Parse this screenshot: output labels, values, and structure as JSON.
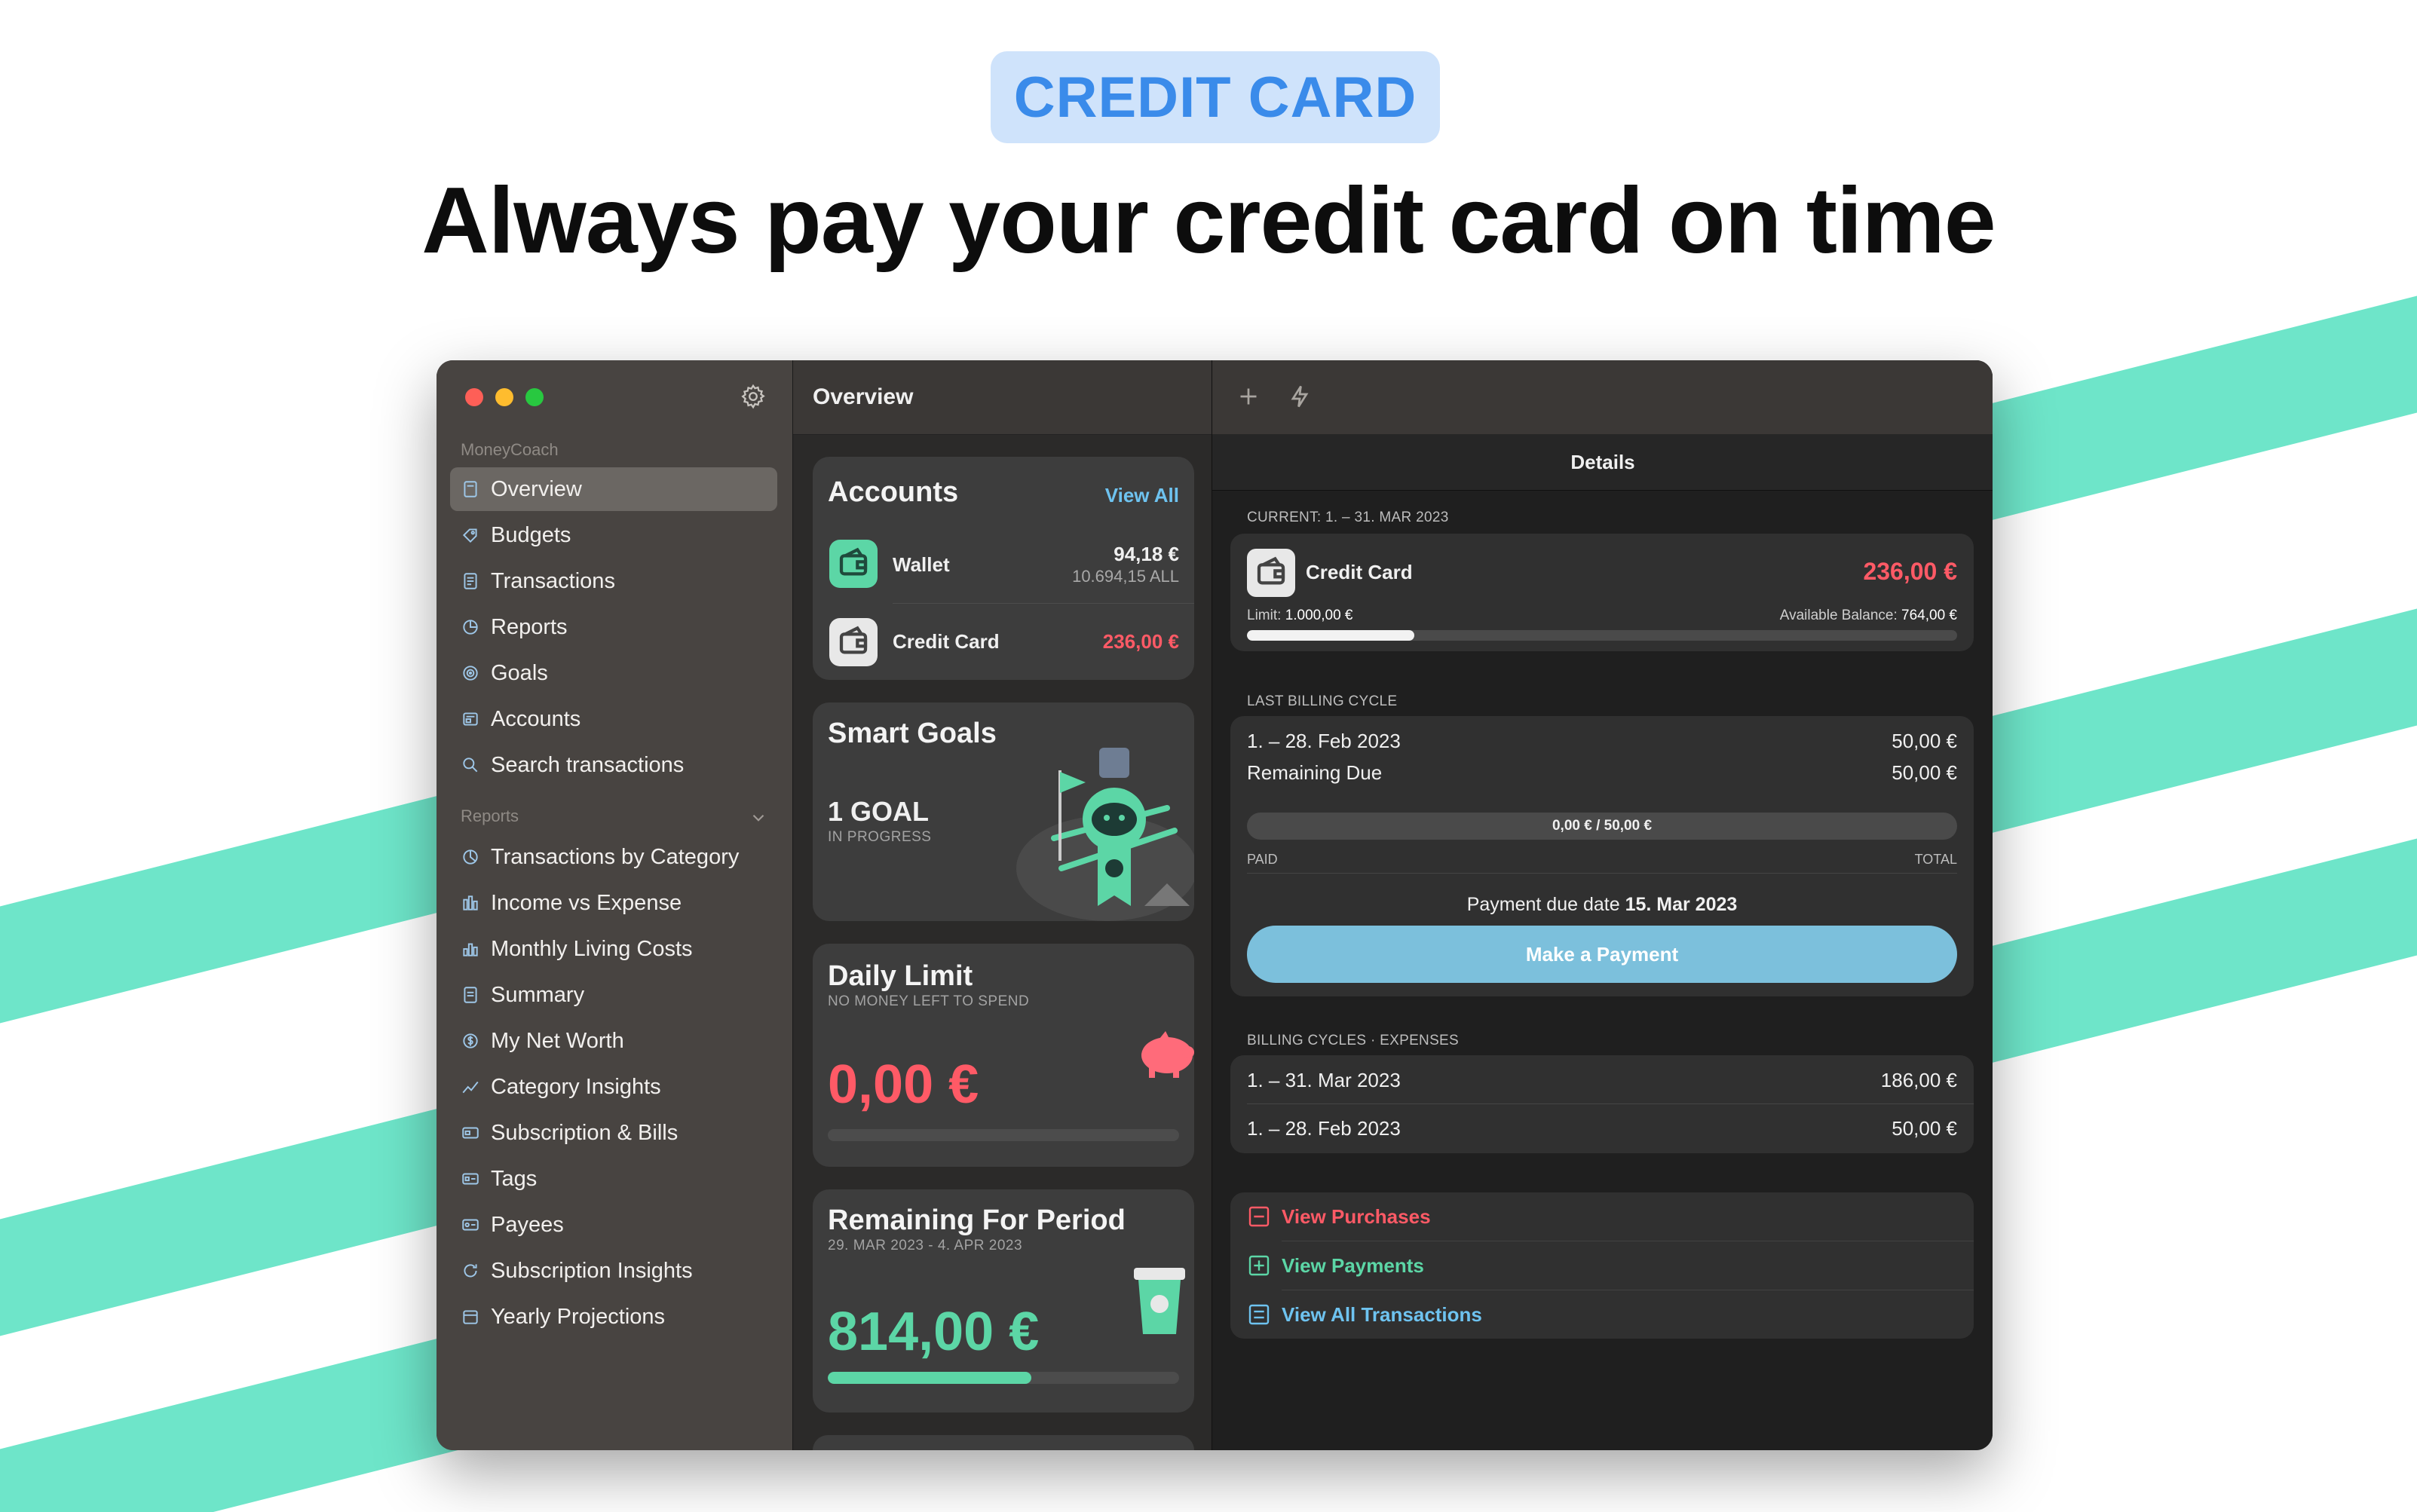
{
  "badge": "CREDIT CARD",
  "headline": "Always pay your credit card on time",
  "colors": {
    "stripe": "#6ee5c9",
    "badge_bg": "#cfe3fb",
    "badge_text": "#3a8bea",
    "negative": "#ff5a66",
    "positive": "#5cd6a6",
    "link_blue": "#6ec3f0",
    "button": "#7cc0dc"
  },
  "sidebar": {
    "app_section": "MoneyCoach",
    "items": [
      {
        "label": "Overview",
        "icon": "overview-icon"
      },
      {
        "label": "Budgets",
        "icon": "budgets-icon"
      },
      {
        "label": "Transactions",
        "icon": "transactions-icon"
      },
      {
        "label": "Reports",
        "icon": "reports-icon"
      },
      {
        "label": "Goals",
        "icon": "goals-icon"
      },
      {
        "label": "Accounts",
        "icon": "accounts-icon"
      },
      {
        "label": "Search transactions",
        "icon": "search-icon"
      }
    ],
    "reports_section": "Reports",
    "reports": [
      {
        "label": "Transactions by Category",
        "icon": "pie-chart-icon"
      },
      {
        "label": "Income vs Expense",
        "icon": "bar-chart-icon"
      },
      {
        "label": "Monthly Living Costs",
        "icon": "bar-chart-icon"
      },
      {
        "label": "Summary",
        "icon": "summary-icon"
      },
      {
        "label": "My Net Worth",
        "icon": "dollar-icon"
      },
      {
        "label": "Category Insights",
        "icon": "line-chart-icon"
      },
      {
        "label": "Subscription & Bills",
        "icon": "card-icon"
      },
      {
        "label": "Tags",
        "icon": "tag-icon"
      },
      {
        "label": "Payees",
        "icon": "payee-icon"
      },
      {
        "label": "Subscription Insights",
        "icon": "refresh-icon"
      },
      {
        "label": "Yearly Projections",
        "icon": "calendar-icon"
      }
    ]
  },
  "overview": {
    "title": "Overview",
    "accounts": {
      "title": "Accounts",
      "view_all": "View All",
      "wallet": {
        "name": "Wallet",
        "value": "94,18 €",
        "sub": "10.694,15 ALL"
      },
      "credit": {
        "name": "Credit Card",
        "value": "236,00 €"
      }
    },
    "smart_goals": {
      "title": "Smart Goals",
      "count": "1 GOAL",
      "status": "IN PROGRESS"
    },
    "daily_limit": {
      "title": "Daily Limit",
      "subtitle": "NO MONEY LEFT TO SPEND",
      "amount": "0,00 €"
    },
    "remaining": {
      "title": "Remaining For Period",
      "period": "29. MAR 2023 - 4. APR 2023",
      "amount": "814,00 €",
      "progress": 0.58
    }
  },
  "details": {
    "title": "Details",
    "current_label": "CURRENT: 1. – 31. MAR 2023",
    "card_name": "Credit Card",
    "card_amount": "236,00 €",
    "limit_label": "Limit:",
    "limit_value": "1.000,00 €",
    "available_label": "Available Balance:",
    "available_value": "764,00 €",
    "usage": 0.236,
    "last_cycle_label": "LAST BILLING CYCLE",
    "last_cycle_period": "1. – 28. Feb 2023",
    "last_cycle_amount": "50,00 €",
    "remaining_due_label": "Remaining Due",
    "remaining_due_amount": "50,00 €",
    "paid_progress": "0,00 € / 50,00 €",
    "paid_label": "PAID",
    "total_label": "TOTAL",
    "due_text": "Payment due date",
    "due_date": "15. Mar 2023",
    "pay_button": "Make a Payment",
    "cycles_label": "BILLING CYCLES · EXPENSES",
    "cycles": [
      {
        "period": "1. – 31. Mar 2023",
        "amount": "186,00 €"
      },
      {
        "period": "1. – 28. Feb 2023",
        "amount": "50,00 €"
      }
    ],
    "links": {
      "purchases": "View Purchases",
      "payments": "View Payments",
      "all": "View All Transactions"
    }
  }
}
